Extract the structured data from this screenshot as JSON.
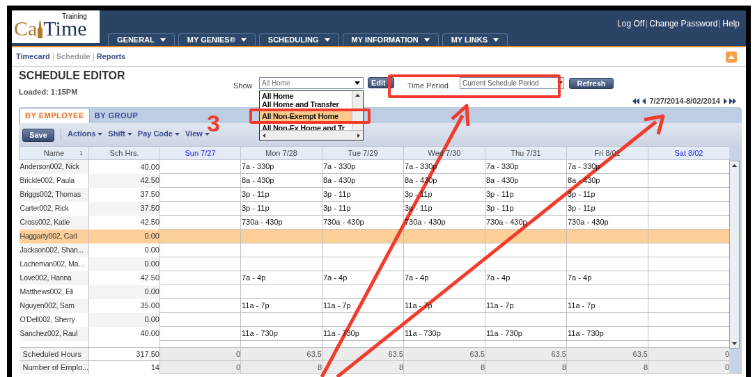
{
  "header": {
    "logo": {
      "caption": "Training",
      "left": "Ca",
      "right": "Time"
    },
    "user_links": [
      "Log Off",
      "Change Password",
      "Help"
    ],
    "menu_tabs": [
      "GENERAL",
      "MY GENIES®",
      "SCHEDULING",
      "MY INFORMATION",
      "MY LINKS"
    ]
  },
  "subnav": [
    {
      "label": "Timecard",
      "selected": false
    },
    {
      "label": "Schedule",
      "selected": true
    },
    {
      "label": "Reports",
      "selected": false
    }
  ],
  "page": {
    "title": "SCHEDULE EDITOR",
    "loaded": "Loaded: 1:15PM"
  },
  "show": {
    "label": "Show",
    "value": "All Home",
    "options": [
      {
        "label": "All Home",
        "highlighted": false
      },
      {
        "label": "All Home and Transfer",
        "highlighted": false
      },
      {
        "label": "All Non-Exempt Home",
        "highlighted": true
      },
      {
        "label": "All Non-Ex Home and Tr",
        "highlighted": false
      }
    ]
  },
  "edit_button": "Edit",
  "time_period": {
    "label": "Time Period",
    "value": "Current Schedule Period"
  },
  "refresh_button": "Refresh",
  "date_range": "7/27/2014-8/02/2014",
  "view_tabs": [
    {
      "label": "BY EMPLOYEE",
      "selected": true
    },
    {
      "label": "BY GROUP",
      "selected": false
    }
  ],
  "toolbar": {
    "save": "Save",
    "menus": [
      "Actions",
      "Shift",
      "Pay Code",
      "View"
    ]
  },
  "grid": {
    "name_column": {
      "label": "Name",
      "sort": "1"
    },
    "hours_column": "Sch Hrs.",
    "days": [
      {
        "label": "Sun 7/27",
        "weekend": true
      },
      {
        "label": "Mon 7/28",
        "weekend": false
      },
      {
        "label": "Tue 7/29",
        "weekend": false
      },
      {
        "label": "Wed 7/30",
        "weekend": false
      },
      {
        "label": "Thu 7/31",
        "weekend": false
      },
      {
        "label": "Fri 8/01",
        "weekend": false
      },
      {
        "label": "Sat 8/02",
        "weekend": true
      }
    ],
    "rows": [
      {
        "name": "Anderson002, Nick",
        "hours": "40.00",
        "selected": false,
        "weekday_shifts": [
          "7a - 330p",
          "7a - 330p",
          "7a - 330p",
          "7a - 330p",
          "7a - 330p"
        ]
      },
      {
        "name": "Brickle002, Paula",
        "hours": "42.50",
        "selected": false,
        "weekday_shifts": [
          "8a - 430p",
          "8a - 430p",
          "8a - 430p",
          "8a - 430p",
          "8a - 430p"
        ]
      },
      {
        "name": "Briggs002, Thomas",
        "hours": "37.50",
        "selected": false,
        "weekday_shifts": [
          "3p - 11p",
          "3p - 11p",
          "3p - 11p",
          "3p - 11p",
          "3p - 11p"
        ]
      },
      {
        "name": "Carter002, Rick",
        "hours": "37.50",
        "selected": false,
        "weekday_shifts": [
          "3p - 11p",
          "3p - 11p",
          "3p - 11p",
          "3p - 11p",
          "3p - 11p"
        ]
      },
      {
        "name": "Cross002, Katie",
        "hours": "42.50",
        "selected": false,
        "weekday_shifts": [
          "730a - 430p",
          "730a - 430p",
          "730a - 430p",
          "730a - 430p",
          "730a - 430p"
        ]
      },
      {
        "name": "Haggarty002, Carl",
        "hours": "0.00",
        "selected": true
      },
      {
        "name": "Jackson002, Shan...",
        "hours": "0.00",
        "selected": false
      },
      {
        "name": "Lacheman002, Ma...",
        "hours": "0.00",
        "selected": false
      },
      {
        "name": "Love002, Hanna",
        "hours": "42.50",
        "selected": false,
        "weekday_shifts": [
          "7a - 4p",
          "7a - 4p",
          "7a - 4p",
          "7a - 4p",
          "7a - 4p"
        ]
      },
      {
        "name": "Matthews002, Eli",
        "hours": "0.00",
        "selected": false
      },
      {
        "name": "Nguyen002, Sam",
        "hours": "35.00",
        "selected": false,
        "weekday_shifts": [
          "11a - 7p",
          "11a - 7p",
          "11a - 7p",
          "11a - 7p",
          "11a - 7p"
        ]
      },
      {
        "name": "O'Dell002, Sherry",
        "hours": "0.00",
        "selected": false
      },
      {
        "name": "Sanchez002, Raul",
        "hours": "40.00",
        "selected": false,
        "weekday_shifts": [
          "11a - 730p",
          "11a - 730p",
          "11a - 730p",
          "11a - 730p",
          "11a - 730p"
        ]
      }
    ],
    "totals": [
      {
        "label": "Scheduled Hours",
        "total": "317.50",
        "values": [
          "0",
          "63.5",
          "63.5",
          "63.5",
          "63.5",
          "63.5",
          "0"
        ]
      },
      {
        "label": "Number of Emplo...",
        "total": "14",
        "values": [
          "0",
          "8",
          "8",
          "8",
          "8",
          "8",
          "0"
        ]
      }
    ]
  },
  "annotation": {
    "step_number": "3"
  }
}
